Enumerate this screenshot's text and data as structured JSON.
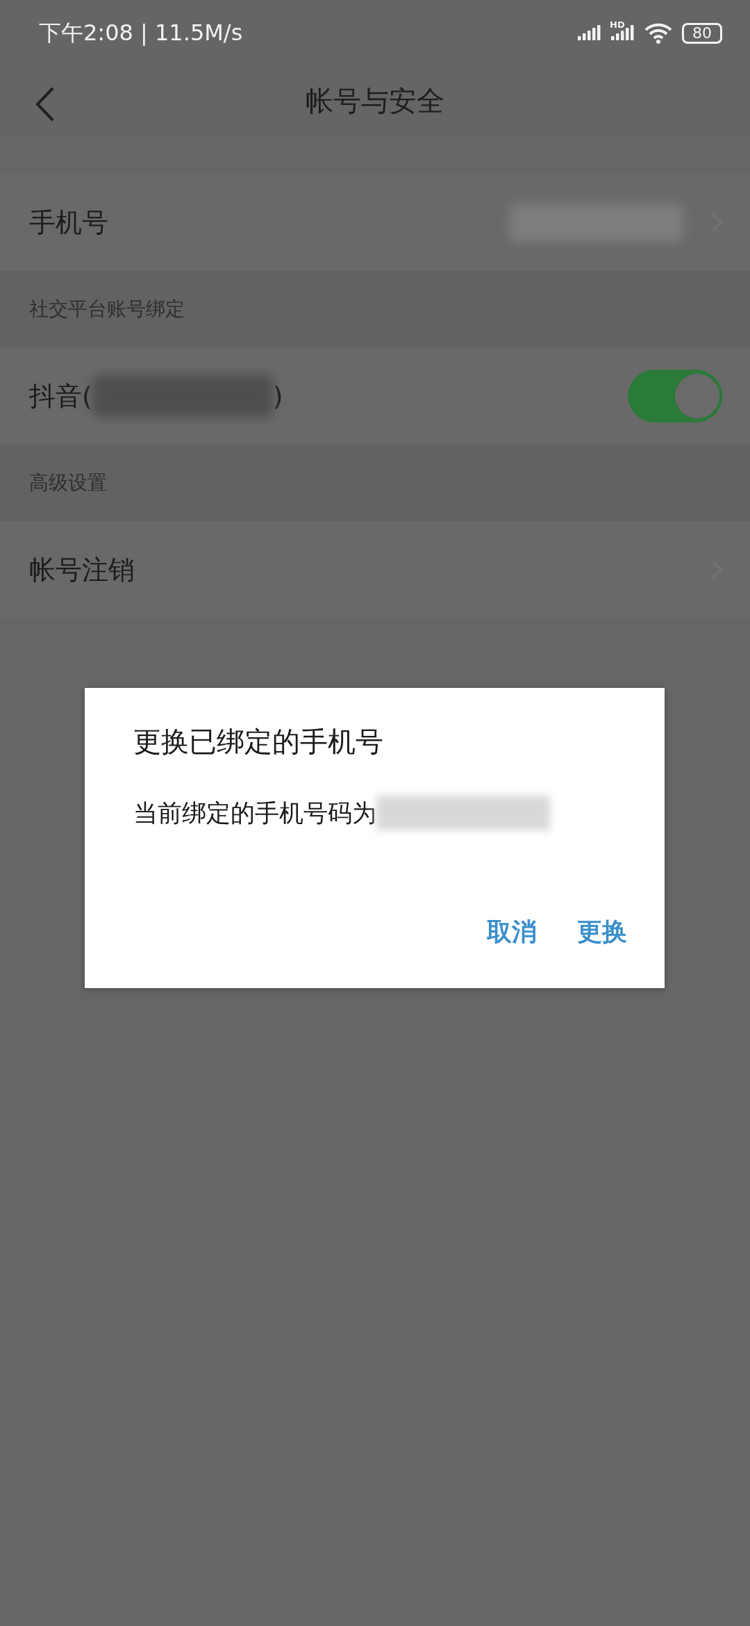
{
  "status_bar": {
    "text": "下午2:08 | 11.5M/s",
    "hd_label": "HD",
    "battery": "80"
  },
  "header": {
    "title": "帐号与安全"
  },
  "sections": [
    {
      "rows": [
        {
          "kind": "link",
          "label": "手机号",
          "redacted": true
        }
      ]
    },
    {
      "title": "社交平台账号绑定",
      "rows": [
        {
          "kind": "toggle",
          "label": "抖音(",
          "suffix": ")",
          "redacted": true,
          "on": true
        }
      ]
    },
    {
      "title": "高级设置",
      "rows": [
        {
          "kind": "link",
          "label": "帐号注销",
          "redacted": false
        }
      ]
    }
  ],
  "dialog": {
    "title": "更换已绑定的手机号",
    "message": "当前绑定的手机号码为",
    "redacted": true,
    "buttons": [
      "取消",
      "更换"
    ]
  }
}
